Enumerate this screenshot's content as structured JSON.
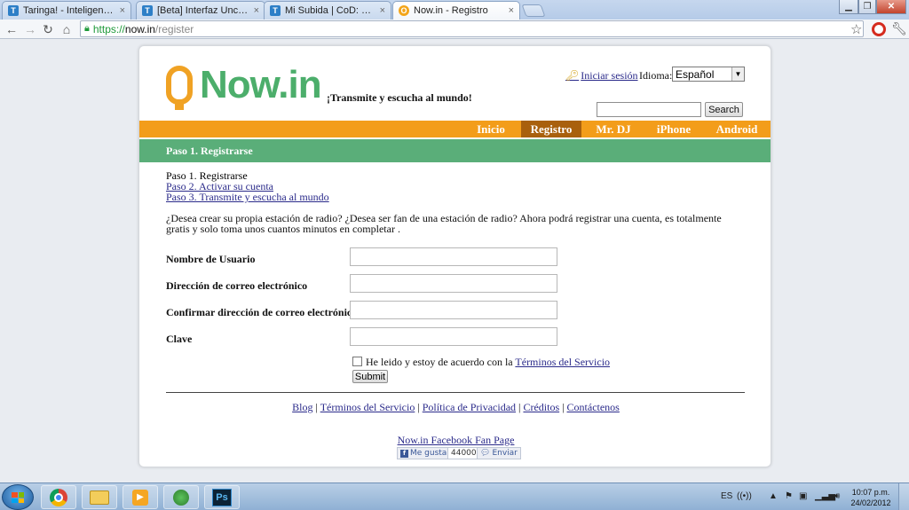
{
  "browser": {
    "tabs": [
      {
        "title": "Taringa! - Inteligencia Cole",
        "favicon": "T",
        "active": false
      },
      {
        "title": "[Beta] Interfaz Uncharted -",
        "favicon": "T",
        "active": false
      },
      {
        "title": "Mi Subida | CoD: World At",
        "favicon": "T",
        "active": false
      },
      {
        "title": "Now.in - Registro",
        "favicon": "O",
        "active": true
      }
    ],
    "tab_close_glyph": "×",
    "url_scheme": "https://",
    "url_host": "now.in",
    "url_path": "/register"
  },
  "site": {
    "logo_text": "Now.in",
    "tagline": "¡Transmite y escucha al mundo!",
    "login_link": "Iniciar sesión",
    "language_label": "Idioma:",
    "language_value": "Español",
    "search_button": "Search",
    "nav": [
      {
        "label": "Inicio",
        "active": false
      },
      {
        "label": "Registro",
        "active": true
      },
      {
        "label": "Mr. DJ",
        "active": false
      },
      {
        "label": "iPhone",
        "active": false
      },
      {
        "label": "Android",
        "active": false
      }
    ],
    "step_header": "Paso 1. Registrarse",
    "steps": [
      "Paso 1. Registrarse",
      "Paso 2. Activar su cuenta",
      "Paso 3. Transmite y escucha al mundo"
    ],
    "intro": "¿Desea crear su propia estación de radio? ¿Desea ser fan de una estación de radio? Ahora podrá registrar una cuenta, es totalmente gratis y solo toma unos cuantos minutos en completar .",
    "form": {
      "username_label": "Nombre de Usuario",
      "email_label": "Dirección de correo electrónico",
      "email_confirm_label": "Confirmar dirección de correo electrónico",
      "password_label": "Clave",
      "terms_prefix": "He leido y estoy de acuerdo con la",
      "terms_link": "Términos del Servicio",
      "submit": "Submit"
    },
    "footer_links": [
      "Blog",
      "Términos del Servicio",
      "Política de Privacidad",
      "Créditos",
      "Contáctenos"
    ],
    "footer_separator": "|",
    "facebook": {
      "page_link": "Now.in Facebook Fan Page",
      "like_label": "Me gusta",
      "like_count": "44000",
      "send_label": "Enviar"
    }
  },
  "taskbar": {
    "language": "ES",
    "time": "10:07 p.m.",
    "date": "24/02/2012",
    "apps": [
      "chrome",
      "explorer",
      "media-player",
      "messenger",
      "photoshop"
    ],
    "photoshop_glyph": "Ps"
  },
  "colors": {
    "nav_orange": "#f39d1a",
    "nav_active": "#a9600d",
    "step_green": "#5aae79",
    "logo_green": "#4cae6b",
    "logo_orange": "#f0a224"
  }
}
